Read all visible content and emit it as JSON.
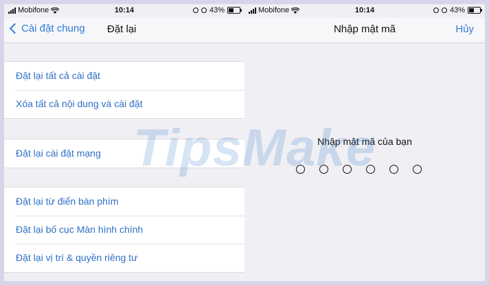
{
  "status": {
    "carrier": "Mobifone",
    "time": "10:14",
    "battery": "43%"
  },
  "left": {
    "back_label": "Cài đặt chung",
    "title": "Đặt lại",
    "groups": [
      [
        "Đặt lại tất cả cài đặt",
        "Xóa tất cả nội dung và cài đặt"
      ],
      [
        "Đặt lại cài đặt mạng"
      ],
      [
        "Đặt lại từ điển bàn phím",
        "Đặt lại bố cục Màn hình chính",
        "Đặt lại vị trí & quyền riêng tư"
      ]
    ]
  },
  "right": {
    "title": "Nhập mật mã",
    "cancel_label": "Hủy",
    "prompt": "Nhập mật mã của bạn",
    "passcode_length": 6
  },
  "watermark": "TipsMake",
  "colors": {
    "link": "#2f7ad6",
    "background": "#efeff4",
    "border": "#d8d4ea"
  },
  "icons": [
    "signal-icon",
    "wifi-icon",
    "alarm-icon",
    "battery-icon",
    "chevron-left-icon"
  ]
}
